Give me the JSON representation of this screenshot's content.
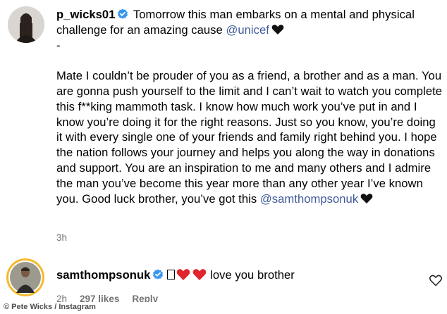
{
  "comments": [
    {
      "username": "p_wicks01",
      "intro": "Tomorrow this man embarks on a mental and physical challenge for an amazing cause",
      "mention": "@unicef",
      "dash": "-",
      "body": "Mate I couldn’t be prouder of you as a friend, a brother and as a man. You are gonna push yourself to the limit and I can’t wait to watch you complete this f**king mammoth task. I know how much work you’ve put in and I know you’re doing it for the right reasons. Just so you know, you’re doing it with every single one of your friends and family right behind you. I hope the nation follows your journey and helps you along the way in donations and support. You are an inspiration to me and many others and I admire the man you’ve become this year more than any other year I’ve known you. Good luck brother, you’ve got this",
      "body_mention": "@samthompsonuk",
      "time": "3h",
      "icons": {
        "verified": "verified-badge-icon",
        "heart": "black-heart-icon"
      }
    },
    {
      "username": "samthompsonuk",
      "text": "love you brother",
      "time": "2h",
      "likes": "297 likes",
      "reply": "Reply",
      "icons": {
        "verified": "verified-badge-icon",
        "hearts": "red-heart-icon",
        "like": "heart-outline-icon"
      }
    }
  ],
  "credit": "© Pete Wicks / Instagram",
  "colors": {
    "verified": "#3897f0",
    "mention": "#3f5a9a",
    "meta": "#737373",
    "red_heart": "#e0252c"
  }
}
